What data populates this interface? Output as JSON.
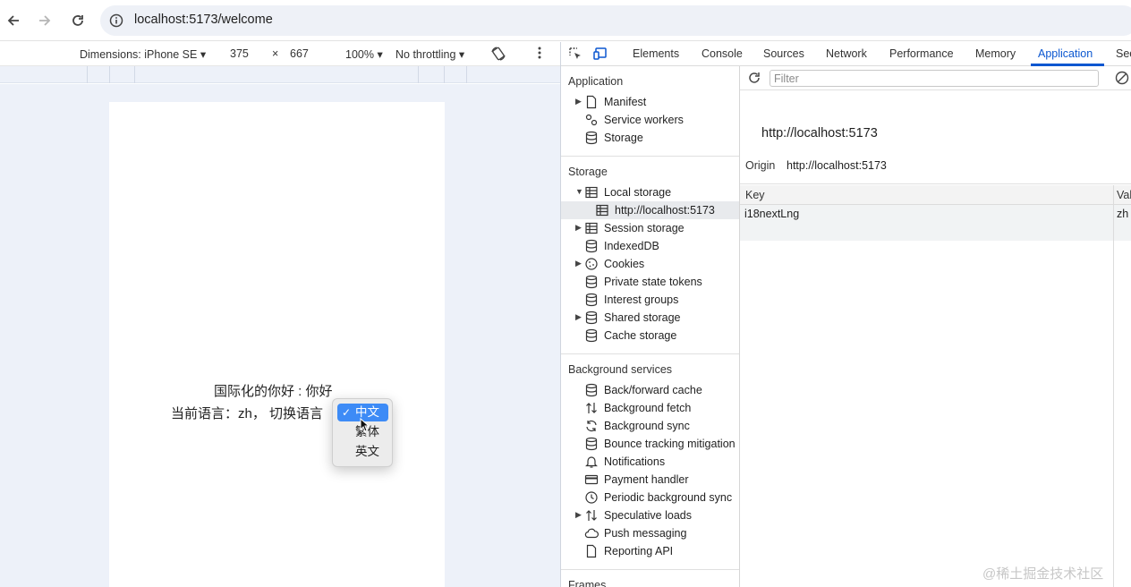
{
  "browser": {
    "url": "localhost:5173/welcome"
  },
  "device_toolbar": {
    "dimensions": "Dimensions: iPhone SE",
    "width": "375",
    "times": "×",
    "height": "667",
    "zoom": "100%",
    "throttling": "No throttling"
  },
  "page": {
    "hello_text": "国际化的你好 : 你好",
    "current_lang": "当前语言：zh， 切换语言",
    "dropdown": {
      "options": [
        "中文",
        "繁体",
        "英文"
      ],
      "selected": "中文"
    }
  },
  "devtools": {
    "tabs": [
      "Elements",
      "Console",
      "Sources",
      "Network",
      "Performance",
      "Memory",
      "Application",
      "Sec"
    ],
    "active_tab": "Application",
    "sidebar": {
      "application_title": "Application",
      "application_items": [
        "Manifest",
        "Service workers",
        "Storage"
      ],
      "storage_title": "Storage",
      "storage_items": [
        "Local storage",
        "http://localhost:5173",
        "Session storage",
        "IndexedDB",
        "Cookies",
        "Private state tokens",
        "Interest groups",
        "Shared storage",
        "Cache storage"
      ],
      "background_title": "Background services",
      "background_items": [
        "Back/forward cache",
        "Background fetch",
        "Background sync",
        "Bounce tracking mitigation",
        "Notifications",
        "Payment handler",
        "Periodic background sync",
        "Speculative loads",
        "Push messaging",
        "Reporting API"
      ],
      "frames_title": "Frames"
    },
    "main": {
      "filter_placeholder": "Filter",
      "origin_title": "http://localhost:5173",
      "origin_label": "Origin",
      "origin_value": "http://localhost:5173",
      "columns": [
        "Key",
        "Val"
      ],
      "rows": [
        {
          "key": "i18nextLng",
          "value": "zh"
        }
      ]
    }
  },
  "watermark": "@稀土掘金技术社区",
  "colors": {
    "accent": "#0b57d0",
    "selection_blue": "#3d8bf6"
  }
}
